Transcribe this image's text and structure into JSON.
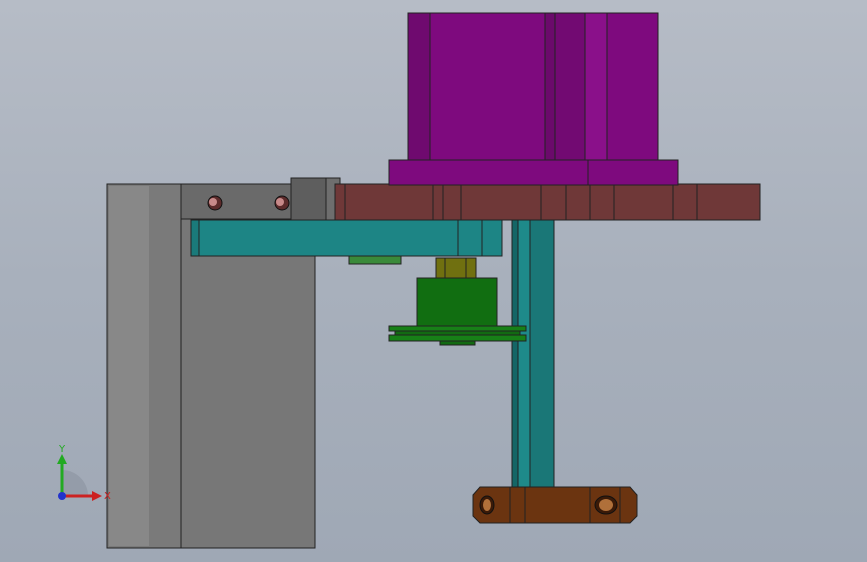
{
  "viewport": {
    "background_top": "#b6bcc6",
    "background_bottom": "#9fa8b5"
  },
  "model": {
    "parts": [
      {
        "name": "motor-housing",
        "color": "#7e0a7e"
      },
      {
        "name": "mounting-plate",
        "color": "#6f3838"
      },
      {
        "name": "support-column",
        "color": "#8a8a8a"
      },
      {
        "name": "side-bracket",
        "color": "#6e6e6e"
      },
      {
        "name": "crossbar",
        "color": "#1d8585"
      },
      {
        "name": "vertical-rod",
        "color": "#1a7777"
      },
      {
        "name": "coupling",
        "color": "#707010"
      },
      {
        "name": "gear-body",
        "color": "#116e11"
      },
      {
        "name": "gear-flange",
        "color": "#178017"
      },
      {
        "name": "bottom-clamp",
        "color": "#6b3410"
      }
    ]
  },
  "triad": {
    "x_label": "X",
    "y_label": "Y",
    "x_color": "#cc2222",
    "y_color": "#22aa22",
    "z_color": "#2233cc"
  }
}
